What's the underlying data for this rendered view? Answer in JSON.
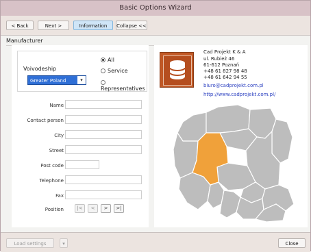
{
  "window": {
    "title": "Basic Options Wizard"
  },
  "toolbar": {
    "back": "< Back",
    "next": "Next >",
    "information": "Information",
    "collapse": "Collapse <<"
  },
  "section": {
    "title": "Manufacturer"
  },
  "filter": {
    "voivodeship_label": "Voivodeship",
    "voivodeship_value": "Greater Poland",
    "radio_all": "All",
    "radio_service": "Service",
    "radio_representatives": "Representatives",
    "selected": "All"
  },
  "form": {
    "name": "Name",
    "contact": "Contact person",
    "city": "City",
    "street": "Street",
    "postcode": "Post code",
    "telephone": "Telephone",
    "fax": "Fax",
    "position": "Position"
  },
  "nav": {
    "first": "|<",
    "prev": "<",
    "next": ">",
    "last": ">|"
  },
  "company": {
    "name": "Cad Projekt K & A",
    "address": "ul. Rubież 46",
    "city": "61-612 Poznań",
    "phone1": "+48 61 827 98 48",
    "phone2": "+48 61 642 94 55",
    "email": "biuro@cadprojekt.com.pl",
    "url": "http://www.cadprojekt.com.pl/"
  },
  "map": {
    "highlight_region": "Greater Poland",
    "highlight_color": "#f0a13a",
    "region_color": "#bdbdbd",
    "border_color": "#ffffff"
  },
  "bottom": {
    "load_settings": "Load settings",
    "close": "Close"
  },
  "colors": {
    "titlebar": "#d8c2c7",
    "accent": "#2f6fd6",
    "logo": "#c25926"
  }
}
